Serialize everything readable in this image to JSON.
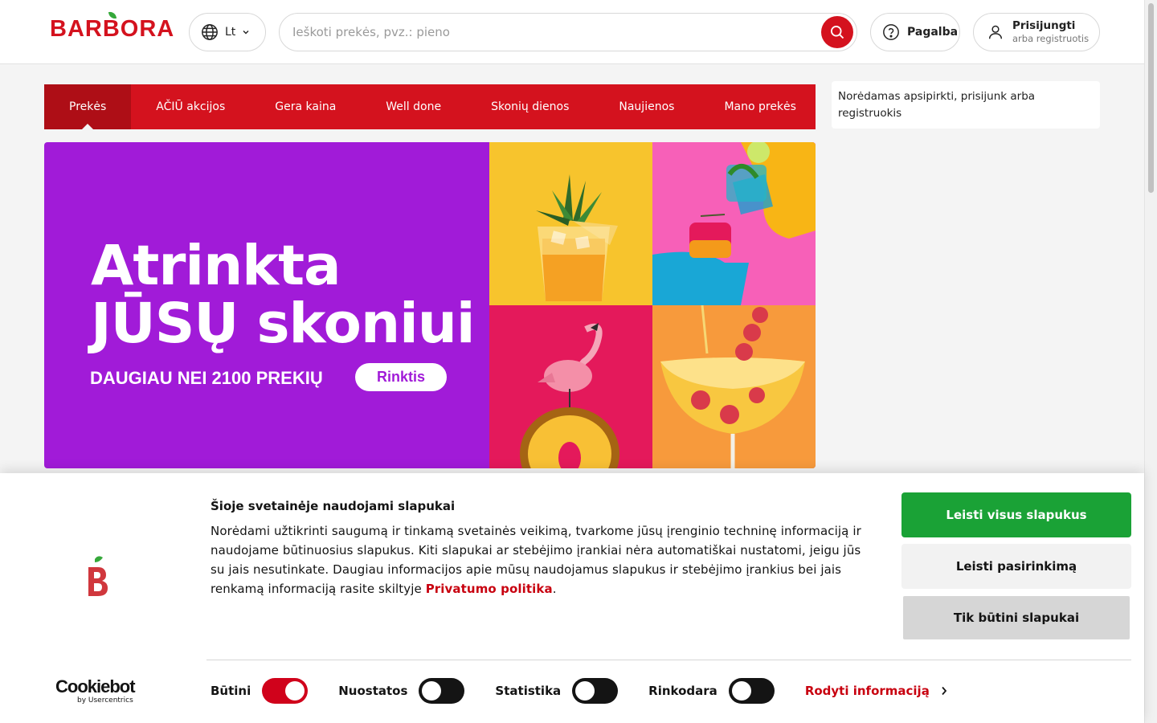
{
  "header": {
    "logo": "BARBORA",
    "language": "Lt",
    "search_placeholder": "Ieškoti prekės, pvz.: pieno",
    "help_label": "Pagalba",
    "login_title": "Prisijungti",
    "login_sub": "arba registruotis"
  },
  "nav": {
    "items": [
      "Prekės",
      "AČIŪ akcijos",
      "Gera kaina",
      "Well done",
      "Skonių dienos",
      "Naujienos",
      "Mano prekės"
    ],
    "active": "Prekės"
  },
  "side_note": "Norėdamas apsipirkti, prisijunk arba registruokis",
  "banner": {
    "title_line1": "Atrinkta",
    "title_line2": "JŪSŲ skoniui",
    "subtitle": "DAUGIAU NEI 2100 PREKIŲ",
    "button": "Rinktis",
    "background": "#a11bd8"
  },
  "cookie": {
    "title": "Šioje svetainėje naudojami slapukai",
    "text": "Norėdami užtikrinti saugumą ir tinkamą svetainės veikimą, tvarkome jūsų įrenginio techninę informaciją ir naudojame būtinuosius slapukus. Kiti slapukai ar stebėjimo įrankiai nėra automatiškai nustatomi, jeigu jūs su jais nesutinkate. Daugiau informacijos apie mūsų naudojamus slapukus ir stebėjimo įrankius bei jais renkamą informaciją rasite skiltyje ",
    "policy_link": "Privatumo politika",
    "text_end": ".",
    "btn_allow_all": "Leisti visus slapukus",
    "btn_allow_selection": "Leisti pasirinkimą",
    "btn_necessary": "Tik būtini slapukai",
    "toggles": [
      {
        "label": "Būtini",
        "on": true
      },
      {
        "label": "Nuostatos",
        "on": false
      },
      {
        "label": "Statistika",
        "on": false
      },
      {
        "label": "Rinkodara",
        "on": false
      }
    ],
    "show_details": "Rodyti informaciją",
    "cookiebot_name": "Cookiebot",
    "cookiebot_by": "by Usercentrics"
  },
  "colors": {
    "brand_red": "#d4121e",
    "green": "#1aa236",
    "purple": "#a11bd8"
  }
}
